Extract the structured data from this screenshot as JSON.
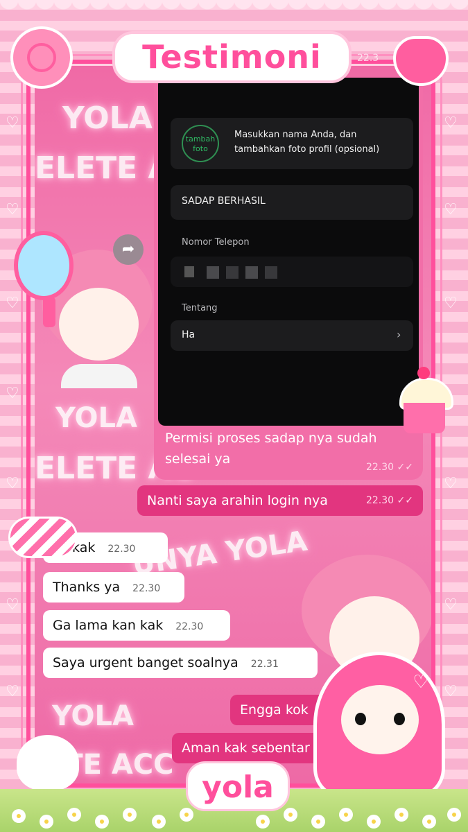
{
  "title": "Testimoni",
  "footer_name": "yola",
  "watermarks": [
    "YOLA",
    "ELETE A",
    "YOLA",
    "ELETE AC",
    "YOLA",
    "UNYA YOLA",
    "YOLA",
    "ETE ACC"
  ],
  "phone": {
    "avatar_label": "tambah foto",
    "profile_hint": "Masukkan nama Anda, dan tambahkan foto profil (opsional)",
    "name_value": "SADAP BERHASIL",
    "phone_label": "Nomor Telepon",
    "about_label": "Tentang",
    "about_value": "Ha",
    "top_time": "22.3"
  },
  "messages": [
    {
      "text": "Permisi proses sadap nya sudah selesai ya",
      "time": "22.30",
      "dir": "out"
    },
    {
      "text": "Nanti saya arahin login nya",
      "time": "22.30",
      "dir": "out"
    },
    {
      "text": "ke kak",
      "time": "22.30",
      "dir": "in"
    },
    {
      "text": "Thanks ya",
      "time": "22.30",
      "dir": "in"
    },
    {
      "text": "Ga lama kan kak",
      "time": "22.30",
      "dir": "in"
    },
    {
      "text": "Saya urgent banget soalnya",
      "time": "22.31",
      "dir": "in"
    },
    {
      "text": "Engga kok",
      "time": "",
      "dir": "out"
    },
    {
      "text": "Aman kak sebentar",
      "time": "",
      "dir": "out"
    }
  ],
  "colors": {
    "accent": "#ff4f9c",
    "bubble_out": "#e2357f",
    "bubble_in": "#ffffff",
    "phone_bg": "#0b0b0c"
  },
  "icons": [
    "rose-icon",
    "strawberry-icon",
    "mirror-icon",
    "cupcake-icon",
    "candy-icon",
    "swan-icon",
    "heart-icon",
    "forward-icon",
    "chevron-right-icon",
    "double-check-icon"
  ]
}
